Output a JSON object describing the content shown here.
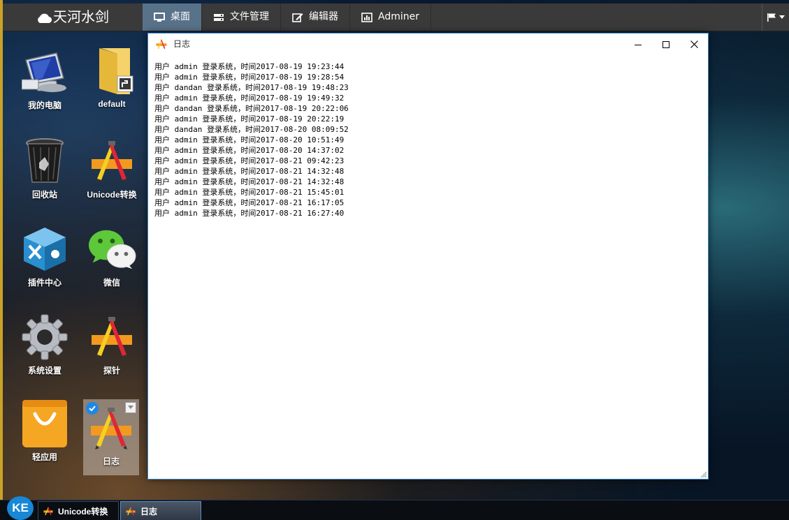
{
  "topbar": {
    "brand": "天河水剑",
    "nav": [
      {
        "label": "桌面",
        "icon": "monitor-icon"
      },
      {
        "label": "文件管理",
        "icon": "drive-icon"
      },
      {
        "label": "编辑器",
        "icon": "edit-icon"
      },
      {
        "label": "Adminer",
        "icon": "chart-icon"
      }
    ],
    "right_icon": "flag-icon"
  },
  "desktop": {
    "icons": [
      {
        "label": "我的电脑",
        "icon": "computer-icon"
      },
      {
        "label": "default",
        "icon": "folder-shortcut-icon"
      },
      {
        "label": "回收站",
        "icon": "recycle-bin-icon"
      },
      {
        "label": "Unicode转换",
        "icon": "app-store-icon"
      },
      {
        "label": "插件中心",
        "icon": "plugin-cube-icon"
      },
      {
        "label": "微信",
        "icon": "wechat-icon"
      },
      {
        "label": "系统设置",
        "icon": "gear-icon"
      },
      {
        "label": "探针",
        "icon": "app-store-icon"
      },
      {
        "label": "轻应用",
        "icon": "shopping-bag-icon"
      },
      {
        "label": "日志",
        "icon": "app-store-icon"
      }
    ]
  },
  "window": {
    "title": "日志",
    "log_lines": [
      "用户 admin 登录系统，时间2017-08-19 19:23:44",
      "用户 admin 登录系统，时间2017-08-19 19:28:54",
      "用户 dandan 登录系统，时间2017-08-19 19:48:23",
      "用户 admin 登录系统，时间2017-08-19 19:49:32",
      "用户 dandan 登录系统，时间2017-08-19 20:22:06",
      "用户 admin 登录系统，时间2017-08-19 20:22:19",
      "用户 dandan 登录系统，时间2017-08-20 08:09:52",
      "用户 admin 登录系统，时间2017-08-20 10:51:49",
      "用户 admin 登录系统，时间2017-08-20 14:37:02",
      "用户 admin 登录系统，时间2017-08-21 09:42:23",
      "用户 admin 登录系统，时间2017-08-21 14:32:48",
      "用户 admin 登录系统，时间2017-08-21 14:32:48",
      "用户 admin 登录系统，时间2017-08-21 15:45:01",
      "用户 admin 登录系统，时间2017-08-21 16:17:05",
      "用户 admin 登录系统，时间2017-08-21 16:27:40"
    ]
  },
  "taskbar": {
    "start_label": "KE",
    "items": [
      {
        "label": "Unicode转换",
        "icon": "app-store-icon"
      },
      {
        "label": "日志",
        "icon": "app-store-icon"
      }
    ]
  },
  "colors": {
    "nav_active": "#587289",
    "topbar": "#3a3a3a",
    "window_border": "#3b87c8",
    "start_button": "#1787d6"
  }
}
